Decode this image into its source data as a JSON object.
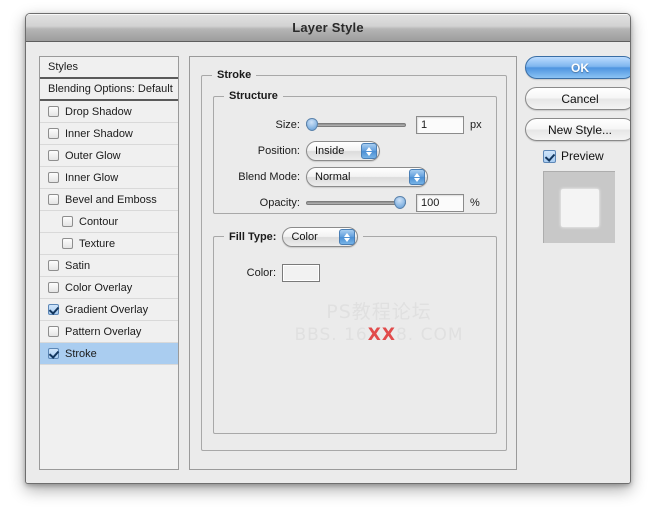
{
  "window": {
    "title": "Layer Style"
  },
  "styles_panel": {
    "header": "Styles",
    "blending_options": "Blending Options: Default",
    "items": [
      {
        "label": "Drop Shadow",
        "checked": false,
        "indent": false,
        "selected": false
      },
      {
        "label": "Inner Shadow",
        "checked": false,
        "indent": false,
        "selected": false
      },
      {
        "label": "Outer Glow",
        "checked": false,
        "indent": false,
        "selected": false
      },
      {
        "label": "Inner Glow",
        "checked": false,
        "indent": false,
        "selected": false
      },
      {
        "label": "Bevel and Emboss",
        "checked": false,
        "indent": false,
        "selected": false
      },
      {
        "label": "Contour",
        "checked": false,
        "indent": true,
        "selected": false
      },
      {
        "label": "Texture",
        "checked": false,
        "indent": true,
        "selected": false
      },
      {
        "label": "Satin",
        "checked": false,
        "indent": false,
        "selected": false
      },
      {
        "label": "Color Overlay",
        "checked": false,
        "indent": false,
        "selected": false
      },
      {
        "label": "Gradient Overlay",
        "checked": true,
        "indent": false,
        "selected": false
      },
      {
        "label": "Pattern Overlay",
        "checked": false,
        "indent": false,
        "selected": false
      },
      {
        "label": "Stroke",
        "checked": true,
        "indent": false,
        "selected": true
      }
    ]
  },
  "stroke_panel": {
    "title": "Stroke",
    "structure": {
      "title": "Structure",
      "size_label": "Size:",
      "size_value": "1",
      "size_unit": "px",
      "size_slider_percent": 0,
      "position_label": "Position:",
      "position_value": "Inside",
      "blend_mode_label": "Blend Mode:",
      "blend_mode_value": "Normal",
      "opacity_label": "Opacity:",
      "opacity_value": "100",
      "opacity_unit": "%",
      "opacity_slider_percent": 100
    },
    "fill": {
      "fill_type_label": "Fill Type:",
      "fill_type_value": "Color",
      "color_label": "Color:",
      "color_swatch_hex": "#f2f2f2"
    },
    "watermark": {
      "line1": "PS教程论坛",
      "line2_prefix": "BBS. 16",
      "line2_red": "XX",
      "line2_suffix": "8. COM"
    }
  },
  "actions": {
    "ok": "OK",
    "cancel": "Cancel",
    "new_style": "New Style...",
    "preview_label": "Preview",
    "preview_checked": true
  },
  "colors": {
    "accent_blue": "#4e94e0",
    "selection_blue": "#aacdf0",
    "panel_gray": "#ebebeb",
    "watermark_red": "#e14b4b"
  }
}
